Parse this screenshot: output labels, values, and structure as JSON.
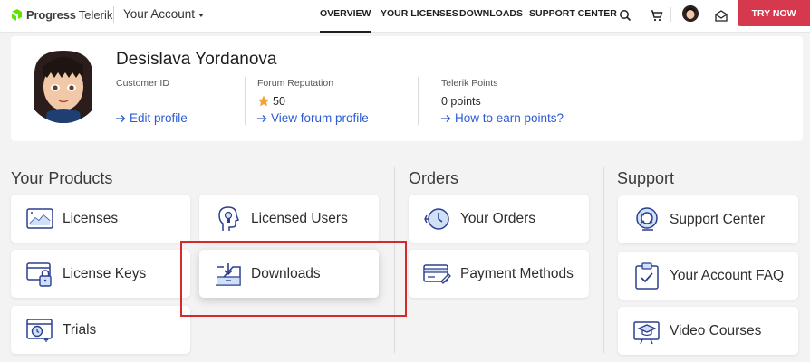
{
  "header": {
    "logo_brand": "Progress",
    "logo_product": "Telerik",
    "account_menu": "Your Account",
    "nav": [
      {
        "label": "OVERVIEW",
        "active": true
      },
      {
        "label": "YOUR LICENSES",
        "active": false
      },
      {
        "label": "DOWNLOADS",
        "active": false
      },
      {
        "label": "SUPPORT CENTER",
        "active": false
      }
    ],
    "icons": [
      "search-icon",
      "cart-icon",
      "user-avatar",
      "messages-icon"
    ],
    "try_now": "TRY NOW",
    "accent_color": "#d6394d"
  },
  "profile": {
    "name": "Desislava Yordanova",
    "customer_id": {
      "label": "Customer ID",
      "value": "",
      "link": "Edit profile"
    },
    "forum": {
      "label": "Forum Reputation",
      "value": "50",
      "link": "View forum profile"
    },
    "points": {
      "label": "Telerik Points",
      "value": "0 points",
      "link": "How to earn points?"
    }
  },
  "sections": {
    "products": {
      "title": "Your Products",
      "tiles": [
        {
          "label": "Licenses",
          "icon": "licenses-icon"
        },
        {
          "label": "Licensed Users",
          "icon": "licensed-users-icon"
        },
        {
          "label": "License Keys",
          "icon": "license-keys-icon"
        },
        {
          "label": "Downloads",
          "icon": "downloads-icon",
          "highlighted": true
        },
        {
          "label": "Trials",
          "icon": "trials-icon"
        }
      ]
    },
    "orders": {
      "title": "Orders",
      "tiles": [
        {
          "label": "Your Orders",
          "icon": "orders-icon"
        },
        {
          "label": "Payment Methods",
          "icon": "payment-methods-icon"
        }
      ]
    },
    "support": {
      "title": "Support",
      "tiles": [
        {
          "label": "Support Center",
          "icon": "support-center-icon"
        },
        {
          "label": "Your Account FAQ",
          "icon": "faq-icon"
        },
        {
          "label": "Video Courses",
          "icon": "video-courses-icon"
        }
      ]
    }
  },
  "link_color": "#2b5bd7",
  "highlight_color": "#d42a2a"
}
